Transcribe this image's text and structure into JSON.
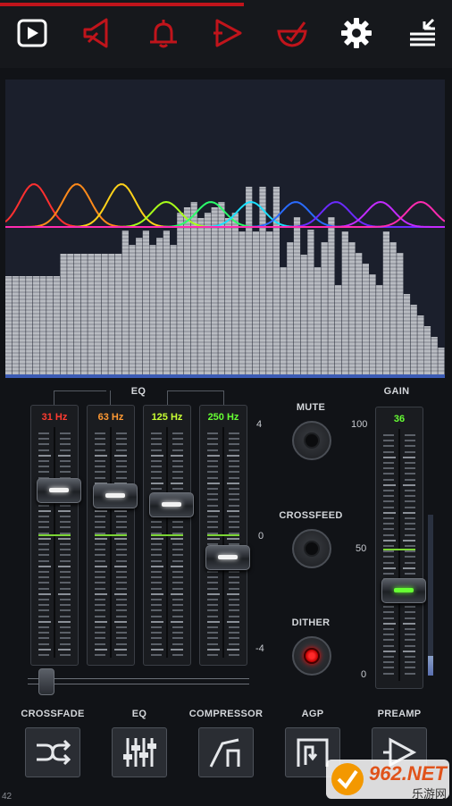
{
  "topbar": {
    "buttons": [
      {
        "name": "play-icon",
        "color": "#ffffff"
      },
      {
        "name": "speaker-icon",
        "color": "#c0141b"
      },
      {
        "name": "bell-icon",
        "color": "#c0141b"
      },
      {
        "name": "play-outline-icon",
        "color": "#c0141b"
      },
      {
        "name": "bowl-check-icon",
        "color": "#c0141b"
      },
      {
        "name": "gear-icon",
        "color": "#ffffff"
      },
      {
        "name": "menu-icon",
        "color": "#ffffff"
      }
    ],
    "playback_progress": 0.54
  },
  "eq": {
    "title": "EQ",
    "bands": [
      {
        "label": "31 Hz",
        "color": "#ff3b30",
        "value_fraction": 0.82
      },
      {
        "label": "63 Hz",
        "color": "#ff9933",
        "value_fraction": 0.8
      },
      {
        "label": "125 Hz",
        "color": "#c8ff33",
        "value_fraction": 0.76
      },
      {
        "label": "250 Hz",
        "color": "#66ff33",
        "value_fraction": 0.53
      }
    ],
    "scale": {
      "top": "4",
      "mid": "0",
      "bottom": "-4"
    }
  },
  "controls": {
    "mute_label": "MUTE",
    "crossfeed_label": "CROSSFEED",
    "dither_label": "DITHER",
    "dither_on": true
  },
  "gain": {
    "title": "GAIN",
    "value": "36",
    "value_fraction": 0.36,
    "scale": {
      "top": "100",
      "mid": "50",
      "bottom": "0"
    },
    "meter_fraction": 0.12
  },
  "bottom": {
    "crossfade_label": "CROSSFADE",
    "eq_label": "EQ",
    "compressor_label": "COMPRESSOR",
    "agp_label": "AGP",
    "preamp_label": "PREAMP"
  },
  "watermark": {
    "text": "962.NET",
    "subtext": "乐游网"
  },
  "corner_text": "42"
}
